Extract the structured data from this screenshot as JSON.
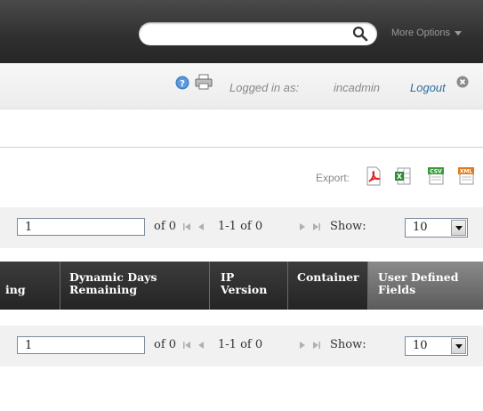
{
  "header": {
    "search_placeholder": "",
    "more_options": "More Options"
  },
  "status": {
    "logged_in_label": "Logged in as:",
    "username": "incadmin",
    "logout": "Logout"
  },
  "export": {
    "label": "Export:",
    "formats": [
      "pdf-icon",
      "excel-icon",
      "csv-icon",
      "xml-icon"
    ]
  },
  "pager_top": {
    "page": "1",
    "of": "of 0",
    "range": "1-1 of 0",
    "show_label": "Show:",
    "show_value": "10"
  },
  "pager_bottom": {
    "page": "1",
    "of": "of 0",
    "range": "1-1 of 0",
    "show_label": "Show:",
    "show_value": "10"
  },
  "table": {
    "headers": [
      "ing",
      "Dynamic Days\nRemaining",
      "IP\nVersion",
      "Container",
      "User Defined\nFields"
    ]
  }
}
